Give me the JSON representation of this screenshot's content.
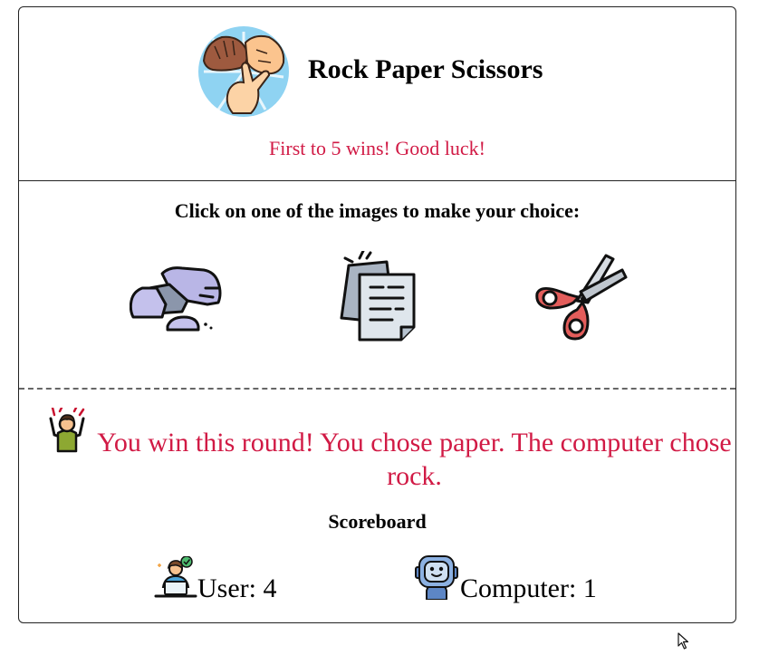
{
  "header": {
    "title": "Rock Paper Scissors",
    "subtitle": "First to 5 wins! Good luck!"
  },
  "choices": {
    "instruction": "Click on one of the images to make your choice:",
    "options": [
      "rock",
      "paper",
      "scissors"
    ]
  },
  "result": {
    "message": "You win this round! You chose paper. The computer chose rock."
  },
  "scoreboard": {
    "title": "Scoreboard",
    "user_text": "User: 4",
    "computer_text": "Computer: 1",
    "user_score": 4,
    "computer_score": 1
  },
  "icons": [
    "hands-logo-icon",
    "rock-icon",
    "paper-icon",
    "scissors-icon",
    "celebrating-person-icon",
    "user-laptop-icon",
    "robot-icon",
    "mouse-cursor-icon"
  ],
  "colors": {
    "accent": "#d11a45",
    "border": "#222222"
  }
}
